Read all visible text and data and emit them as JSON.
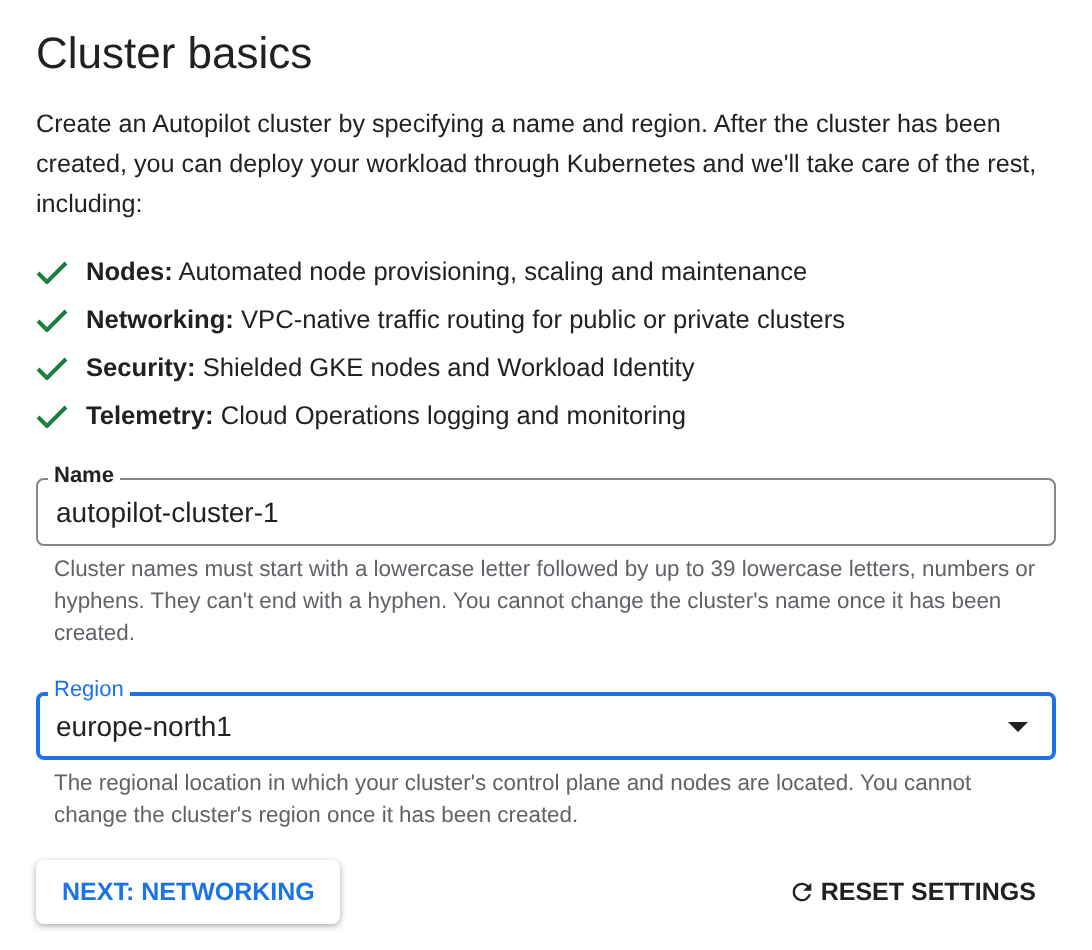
{
  "title": "Cluster basics",
  "intro": "Create an Autopilot cluster by specifying a name and region. After the cluster has been created, you can deploy your workload through Kubernetes and we'll take care of the rest, including:",
  "features": [
    {
      "text": "**Nodes:** Automated node provisioning, scaling and maintenance"
    },
    {
      "text": "**Networking:** VPC-native traffic routing for public or private clusters"
    },
    {
      "text": "**Security:** Shielded GKE nodes and Workload Identity"
    },
    {
      "text": "**Telemetry:** Cloud Operations logging and monitoring"
    }
  ],
  "fields": [
    {
      "kind": "text",
      "label": "Name",
      "value": "autopilot-cluster-1",
      "focused": false,
      "help": "Cluster names must start with a lowercase letter followed by up to 39 lowercase letters, numbers or hyphens. They can't end with a hyphen. You cannot change the cluster's name once it has been created."
    },
    {
      "kind": "select",
      "label": "Region",
      "value": "europe-north1",
      "focused": true,
      "help": "The regional location in which your cluster's control plane and nodes are located. You cannot change the cluster's region once it has been created."
    }
  ],
  "buttons": {
    "next": "NEXT: NETWORKING",
    "reset": "RESET SETTINGS"
  }
}
